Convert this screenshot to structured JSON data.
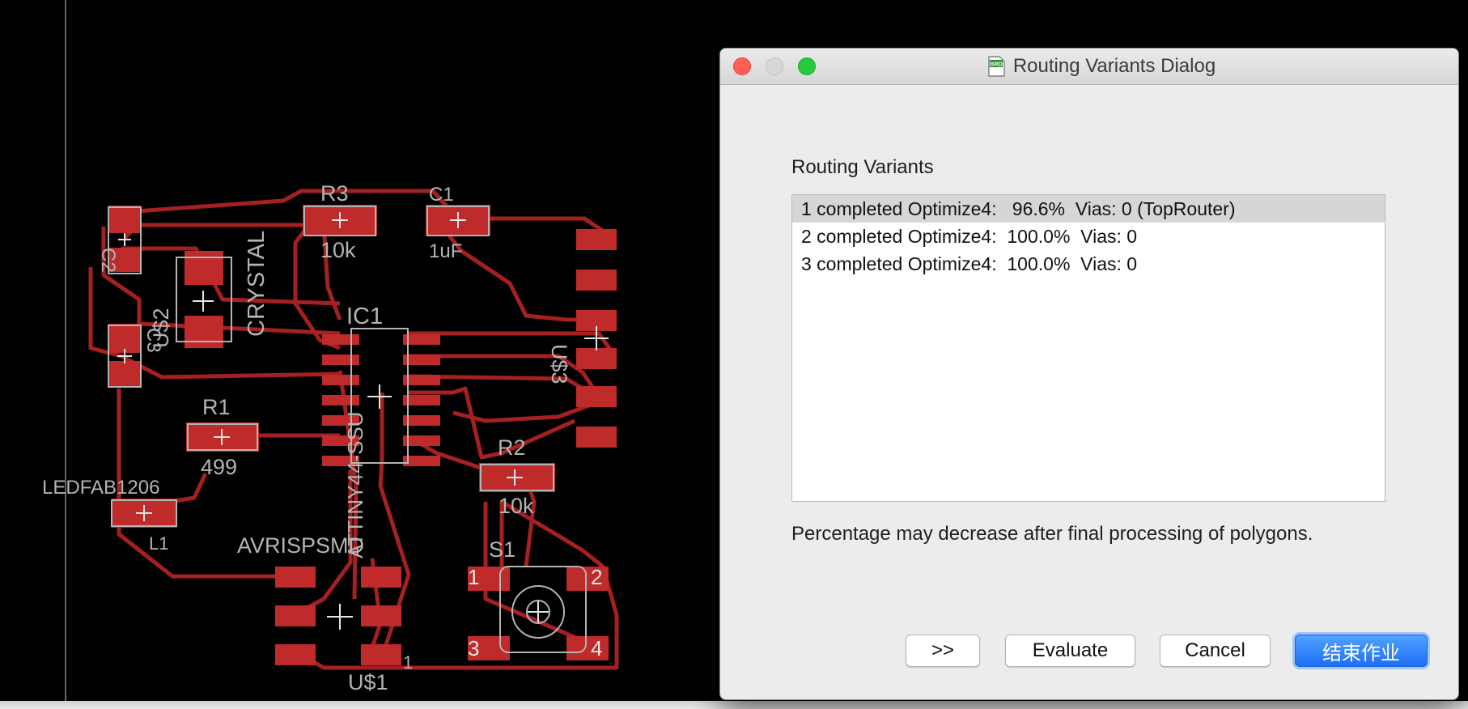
{
  "board": {
    "labels": {
      "r3_name": "R3",
      "r3_value": "10k",
      "c1_name": "C1",
      "c1_value": "1uF",
      "c2_name": "C2",
      "us2_name": "U$2",
      "crystal": "CRYSTAL",
      "c3_name": "C3",
      "ic1_name": "IC1",
      "ic1_value": "ATTINY44-SSU",
      "r1_name": "R1",
      "r1_value": "499",
      "led_name": "LEDFAB1206",
      "l1_name": "L1",
      "avrisp": "AVRISPSMD",
      "us1_name": "U$1",
      "pin1": "1",
      "us3_name": "U$3",
      "r2_name": "R2",
      "r2_value": "10k",
      "s1_name": "S1",
      "s1_pin1": "1",
      "s1_pin2": "2",
      "s1_pin3": "3",
      "s1_pin4": "4"
    },
    "colors": {
      "copper": "#bf2a2a",
      "trace": "#a52020",
      "silk": "#b4b4b4",
      "background": "#000000"
    }
  },
  "dialog": {
    "title": "Routing Variants Dialog",
    "window_icon": "brd-file-icon",
    "section_label": "Routing Variants",
    "variants": [
      {
        "text": "1 completed Optimize4:   96.6%  Vias: 0 (TopRouter)",
        "selected": true
      },
      {
        "text": "2 completed Optimize4:  100.0%  Vias: 0",
        "selected": false
      },
      {
        "text": "3 completed Optimize4:  100.0%  Vias: 0",
        "selected": false
      }
    ],
    "note": "Percentage may decrease after final processing of polygons.",
    "buttons": {
      "more": ">>",
      "evaluate": "Evaluate",
      "cancel": "Cancel",
      "finish": "结束作业"
    },
    "accent_color": "#2a7bf6"
  }
}
